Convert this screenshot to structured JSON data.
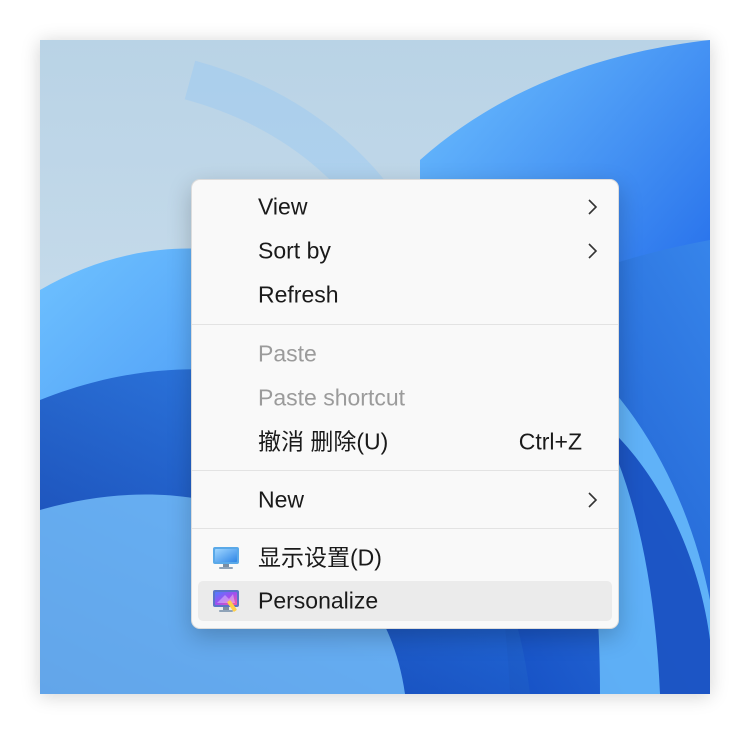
{
  "context_menu": {
    "items": [
      {
        "label": "View",
        "has_submenu": true,
        "enabled": true
      },
      {
        "label": "Sort by",
        "has_submenu": true,
        "enabled": true
      },
      {
        "label": "Refresh",
        "enabled": true
      },
      {
        "label": "Paste",
        "enabled": false
      },
      {
        "label": "Paste shortcut",
        "enabled": false
      },
      {
        "label": "撤消 删除(U)",
        "shortcut": "Ctrl+Z",
        "enabled": true
      },
      {
        "label": "New",
        "has_submenu": true,
        "enabled": true
      },
      {
        "label": "显示设置(D)",
        "icon": "display-settings-icon",
        "enabled": true
      },
      {
        "label": "Personalize",
        "icon": "personalize-icon",
        "enabled": true,
        "highlighted": true
      }
    ]
  },
  "colors": {
    "menu_background": "#f9f9f9",
    "disabled_text": "#9b9b9b",
    "hover_background": "#ebebeb",
    "wallpaper_blue": "#1565e0"
  }
}
